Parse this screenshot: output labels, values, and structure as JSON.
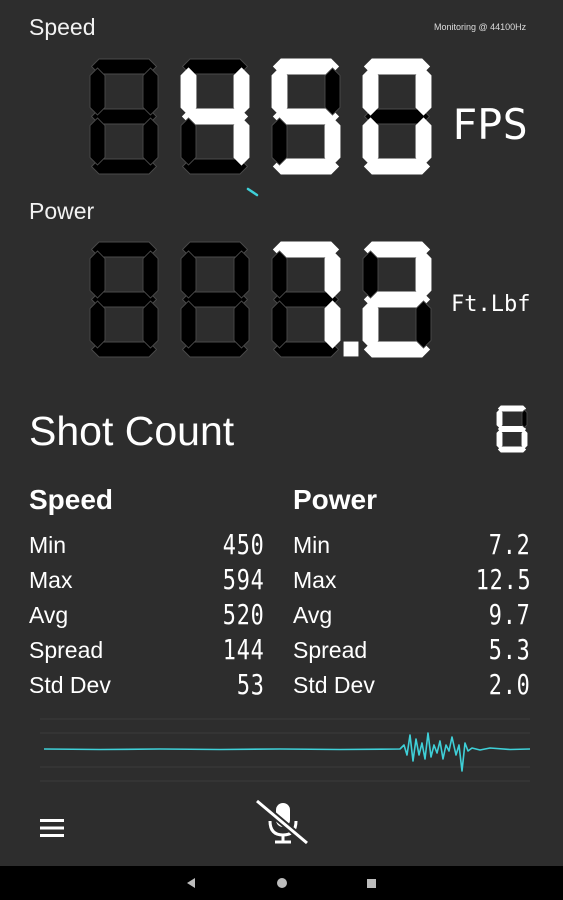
{
  "header": {
    "speed_label": "Speed",
    "monitoring_text": "Monitoring @ 44100Hz",
    "power_label": "Power"
  },
  "speed_display": {
    "digits": "450",
    "unit": "FPS"
  },
  "power_display": {
    "value": "7.2",
    "unit": "Ft.Lbf"
  },
  "shot_count": {
    "label": "Shot Count",
    "value": "6"
  },
  "stats": {
    "speed": {
      "title": "Speed",
      "rows": [
        {
          "name": "Min",
          "value": "450"
        },
        {
          "name": "Max",
          "value": "594"
        },
        {
          "name": "Avg",
          "value": "520"
        },
        {
          "name": "Spread",
          "value": "144"
        },
        {
          "name": "Std Dev",
          "value": "53"
        }
      ]
    },
    "power": {
      "title": "Power",
      "rows": [
        {
          "name": "Min",
          "value": "7.2"
        },
        {
          "name": "Max",
          "value": "12.5"
        },
        {
          "name": "Avg",
          "value": "9.7"
        },
        {
          "name": "Spread",
          "value": "5.3"
        },
        {
          "name": "Std Dev",
          "value": "2.0"
        }
      ]
    }
  },
  "colors": {
    "waveform": "#3fd0d8",
    "background": "#2d2d2d"
  },
  "icons": {
    "menu": "hamburger-menu-icon",
    "mic": "mic-off-icon"
  }
}
